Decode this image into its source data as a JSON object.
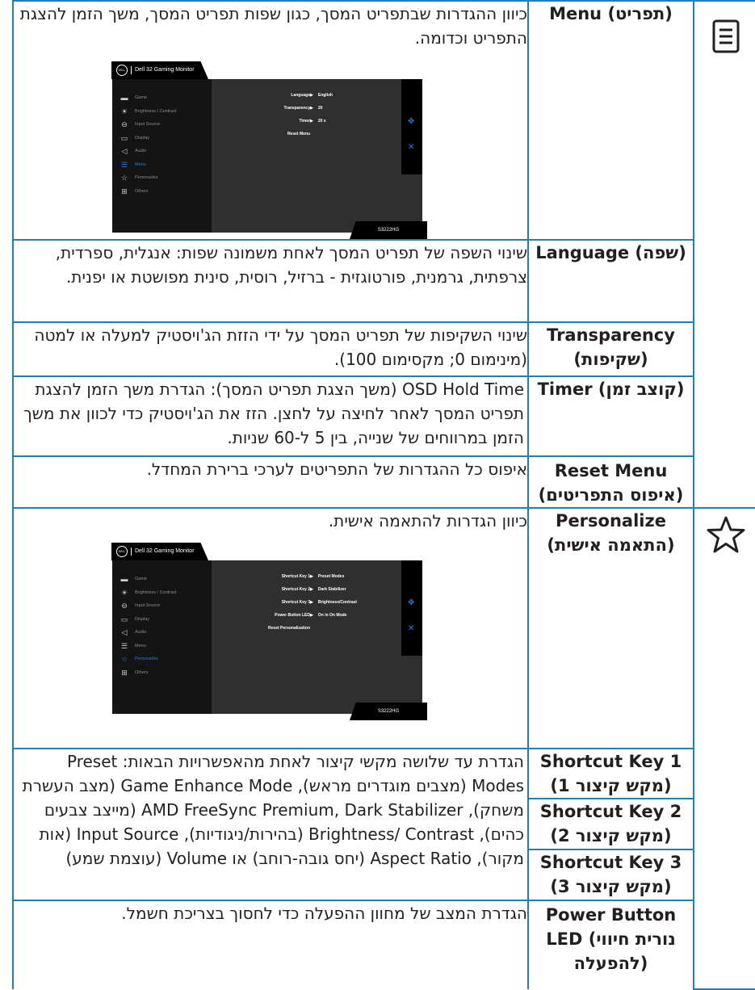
{
  "rows": {
    "menu": {
      "icon": "menu-icon",
      "name": "Menu (תפריט)",
      "desc": "כיוון ההגדרות שבתפריט המסך, כגון שפות תפריט המסך, משך הזמן להצגת התפריט וכדומה.",
      "osd": {
        "header": "Dell 32 Gaming Monitor",
        "logo": "DELL",
        "model": "S3222HG",
        "side_items": [
          "Game",
          "Brightness / Contrast",
          "Input Source",
          "Display",
          "Audio",
          "Menu",
          "Personalize",
          "Others"
        ],
        "active_index": 5,
        "options": [
          {
            "key": "Language",
            "value": "English"
          },
          {
            "key": "Transparency",
            "value": "20"
          },
          {
            "key": "Timer",
            "value": "20 s"
          },
          {
            "key": "Reset Menu",
            "value": ""
          }
        ]
      }
    },
    "language": {
      "name": "Language (שפה)",
      "desc": "שינוי השפה של תפריט המסך לאחת משמונה שפות: אנגלית, ספרדית, צרפתית, גרמנית, פורטוגזית - ברזיל, רוסית, סינית מפושטת או יפנית."
    },
    "transparency": {
      "name": "Transparency (שקיפות)",
      "desc": "שינוי השקיפות של תפריט המסך על ידי הזזת הג'ויסטיק למעלה או למטה (מינימום 0; מקסימום 100)."
    },
    "timer": {
      "name": "Timer (קוצב זמן)",
      "desc": "OSD Hold Time (משך הצגת תפריט המסך): הגדרת משך הזמן להצגת תפריט המסך לאחר לחיצה על לחצן. הזז את הג'ויסטיק כדי לכוון את משך הזמן במרווחים של שנייה, בין 5 ל-60 שניות."
    },
    "reset_menu": {
      "name": "Reset Menu (איפוס התפריטים)",
      "desc": "איפוס כל ההגדרות של התפריטים לערכי ברירת המחדל."
    },
    "personalize": {
      "icon": "star-icon",
      "name": "Personalize (התאמה אישית)",
      "desc": "כיוון הגדרות להתאמה אישית.",
      "osd": {
        "header": "Dell 32 Gaming Monitor",
        "logo": "DELL",
        "model": "S3222HG",
        "side_items": [
          "Game",
          "Brightness / Contrast",
          "Input Source",
          "Display",
          "Audio",
          "Menu",
          "Personalize",
          "Others"
        ],
        "active_index": 6,
        "options": [
          {
            "key": "Shortcut Key 1",
            "value": "Preset Modes"
          },
          {
            "key": "Shortcut Key 2",
            "value": "Dark Stabilizer"
          },
          {
            "key": "Shortcut Key 3",
            "value": "Brightness/Contrast"
          },
          {
            "key": "Power Button LED",
            "value": "On in On Mode"
          },
          {
            "key": "Reset Personalization",
            "value": ""
          }
        ]
      }
    },
    "shortcut1": {
      "name": "Shortcut Key 1 (מקש קיצור 1)"
    },
    "shortcut2": {
      "name": "Shortcut Key 2 (מקש קיצור 2)"
    },
    "shortcut3": {
      "name": "Shortcut Key 3 (מקש קיצור 3)"
    },
    "shortcut_desc": "הגדרת עד שלושה מקשי קיצור לאחת מהאפשרויות הבאות: Preset Modes (מצבים מוגדרים מראש), Game Enhance Mode (מצב העשרת משחק), AMD FreeSync Premium, Dark Stabilizer (מייצב צבעים כהים), Brightness/ Contrast (בהירות/ניגודיות), Input Source (אות מקור), Aspect Ratio (יחס גובה-רוחב) או Volume (עוצמת שמע)",
    "power_led": {
      "name": "Power Button LED (נורית חיווי להפעלה)",
      "desc": "הגדרת המצב של מחוון ההפעלה כדי לחסוך בצריכת חשמל."
    }
  }
}
